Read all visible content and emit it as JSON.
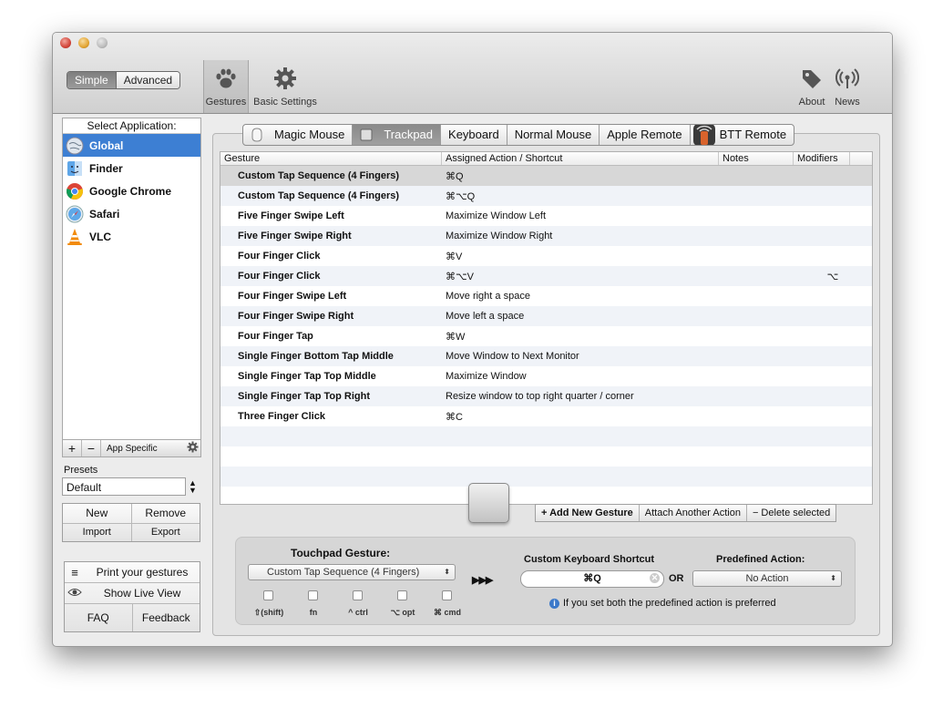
{
  "toolbar": {
    "mode_simple": "Simple",
    "mode_advanced": "Advanced",
    "gestures_label": "Gestures",
    "basic_settings_label": "Basic Settings",
    "about_label": "About",
    "news_label": "News"
  },
  "sidebar": {
    "header": "Select Application:",
    "apps": [
      {
        "name": "Global",
        "icon": "globe-icon"
      },
      {
        "name": "Finder",
        "icon": "finder-icon"
      },
      {
        "name": "Google Chrome",
        "icon": "chrome-icon"
      },
      {
        "name": "Safari",
        "icon": "safari-icon"
      },
      {
        "name": "VLC",
        "icon": "vlc-icon"
      }
    ],
    "add_symbol": "+",
    "remove_symbol": "−",
    "app_specific_label": "App Specific"
  },
  "presets": {
    "label": "Presets",
    "selected": "Default",
    "new_label": "New",
    "remove_label": "Remove",
    "import_label": "Import",
    "export_label": "Export"
  },
  "bottom_buttons": {
    "print_label": "Print your gestures",
    "live_view_label": "Show Live View",
    "faq_label": "FAQ",
    "feedback_label": "Feedback"
  },
  "tabs": [
    {
      "label": "Magic Mouse",
      "icon": "magic-mouse-icon"
    },
    {
      "label": "Trackpad",
      "icon": "trackpad-icon"
    },
    {
      "label": "Keyboard"
    },
    {
      "label": "Normal Mouse"
    },
    {
      "label": "Apple Remote"
    },
    {
      "label": "BTT Remote",
      "icon": "btt-remote-icon"
    }
  ],
  "table": {
    "headers": [
      "Gesture",
      "Assigned Action / Shortcut",
      "Notes",
      "Modifiers"
    ],
    "rows": [
      {
        "gesture": "Custom Tap Sequence (4 Fingers)",
        "action": "⌘Q",
        "notes": "",
        "modifiers": ""
      },
      {
        "gesture": "Custom Tap Sequence (4 Fingers)",
        "action": "⌘⌥Q",
        "notes": "",
        "modifiers": ""
      },
      {
        "gesture": "Five Finger Swipe Left",
        "action": "Maximize Window Left",
        "notes": "",
        "modifiers": ""
      },
      {
        "gesture": "Five Finger Swipe Right",
        "action": "Maximize Window Right",
        "notes": "",
        "modifiers": ""
      },
      {
        "gesture": "Four Finger Click",
        "action": "⌘V",
        "notes": "",
        "modifiers": ""
      },
      {
        "gesture": "Four Finger Click",
        "action": "⌘⌥V",
        "notes": "",
        "modifiers": "⌥"
      },
      {
        "gesture": "Four Finger Swipe Left",
        "action": "Move right a space",
        "notes": "",
        "modifiers": ""
      },
      {
        "gesture": "Four Finger Swipe Right",
        "action": "Move left a space",
        "notes": "",
        "modifiers": ""
      },
      {
        "gesture": "Four Finger Tap",
        "action": "⌘W",
        "notes": "",
        "modifiers": ""
      },
      {
        "gesture": "Single Finger Bottom Tap Middle",
        "action": "Move Window to Next Monitor",
        "notes": "",
        "modifiers": ""
      },
      {
        "gesture": "Single Finger Tap Top Middle",
        "action": "Maximize Window",
        "notes": "",
        "modifiers": ""
      },
      {
        "gesture": "Single Finger Tap Top Right",
        "action": "Resize window to top right quarter / corner",
        "notes": "",
        "modifiers": ""
      },
      {
        "gesture": "Three Finger Click",
        "action": "⌘C",
        "notes": "",
        "modifiers": ""
      }
    ],
    "add_gesture_label": "+ Add New Gesture",
    "attach_action_label": "Attach Another Action",
    "delete_label": "− Delete selected"
  },
  "editor": {
    "touchpad_title": "Touchpad Gesture:",
    "gesture_selected": "Custom Tap Sequence (4 Fingers)",
    "modifiers": [
      {
        "label": "⇧(shift)"
      },
      {
        "label": "fn"
      },
      {
        "label": "^ ctrl"
      },
      {
        "label": "⌥ opt"
      },
      {
        "label": "⌘ cmd"
      }
    ],
    "arrows": "▶▶▶",
    "keyboard_title": "Custom Keyboard Shortcut",
    "keyboard_value": "⌘Q",
    "or_label": "OR",
    "predefined_title": "Predefined Action:",
    "predefined_selected": "No Action",
    "info_text": "If you set both the predefined action is preferred"
  }
}
